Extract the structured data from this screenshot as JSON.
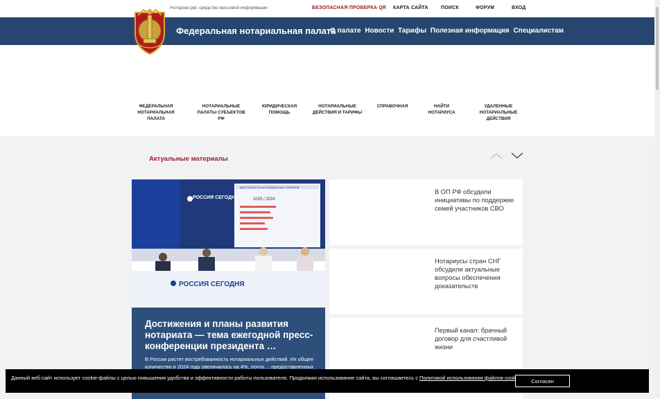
{
  "topbar": {
    "tagline": "Нотариат.рф: средство массовой информации",
    "links": [
      "БЕЗОПАСНАЯ ПРОВЕРКА QR",
      "КАРТА САЙТА",
      "ПОИСК",
      "ФОРУМ",
      "ВХОД"
    ]
  },
  "header": {
    "brand": "Федеральная нотариальная палата",
    "nav": [
      "О палате",
      "Новости",
      "Тарифы",
      "Полезная информация",
      "Специалистам"
    ]
  },
  "categories": [
    "ФЕДЕРАЛЬНАЯ НОТАРИАЛЬНАЯ ПАЛАТА",
    "НОТАРИАЛЬНЫЕ ПАЛАТЫ СУБЪЕКТОВ РФ",
    "ЮРИДИЧЕСКАЯ ПОМОЩЬ",
    "НОТАРИАЛЬНЫЕ ДЕЙСТВИЯ И ТАРИФЫ",
    "СПРАВОЧНАЯ",
    "НАЙТИ НОТАРИУСА",
    "УДАЛЕННЫЕ НОТАРИАЛЬНЫЕ ДЕЙСТВИЯ"
  ],
  "section": {
    "title": "Актуальные материалы"
  },
  "featured": {
    "title": "Достижения и планы развития нотариата — тема ежегодной пресс-конференции президента …",
    "excerpt": "В России растет востребованность нотариальных действий. Их общее количество в 2024 году увеличилось на 4%, почти ... предоставленных нотариусами льгот достиг 5 млрд рублей.",
    "photo": {
      "banner_left": "РОССИЯ СЕГОДНЯ",
      "banner_bottom": "РОССИЯ СЕГОДНЯ",
      "screen_title": "ДОСТУПНОСТЬ НОТАРИАЛЬНЫХ ТАРИФОВ",
      "screen_label": "2025 / 2024"
    }
  },
  "news": [
    "В ОП РФ обсудили инициативы по поддержке семей участников СВО",
    "Нотариусы стран СНГ обсудили актуальные вопросы обеспечения доказательств",
    "Первый канал: брачный договор для счастливой жизни"
  ],
  "cookie": {
    "message": "Данный веб-сайт использует cookie-файлы с целью повышения удобства и эффективности работы пользователя. Продолжая использование сайта, вы соглашаетесь с ",
    "link": "Политикой использования файлов cookie",
    "suffix": ".",
    "button": "Согласен"
  },
  "colors": {
    "brand_blue": "#27466f",
    "accent_red": "#9b1c22",
    "feature_blue": "#2c4f7c"
  }
}
